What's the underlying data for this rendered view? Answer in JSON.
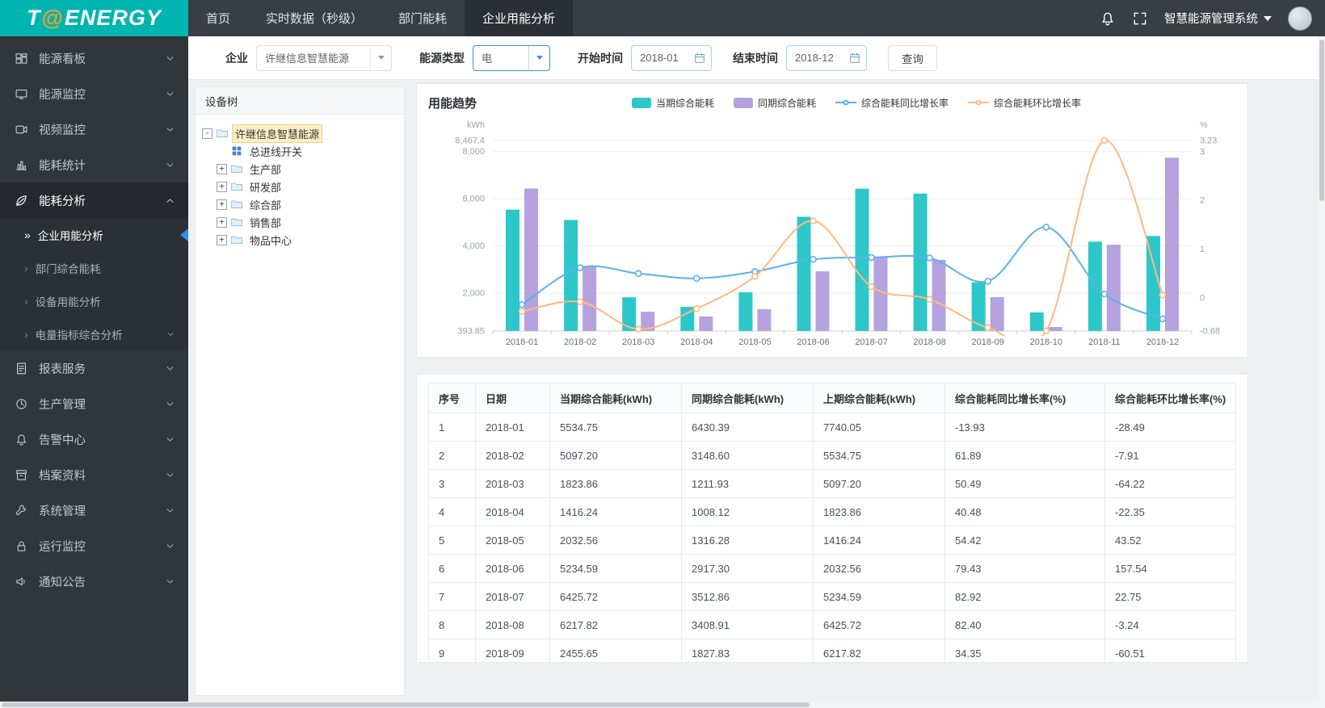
{
  "app": {
    "logo": {
      "part1": "T",
      "at": "@",
      "part2": "ENERGY"
    },
    "system_title": "智慧能源管理系统"
  },
  "colors": {
    "brand_teal": "#00b5b0",
    "bar_current": "#2ec7c9",
    "bar_same_period": "#b6a2de",
    "line_yoy": "#5ab1ef",
    "line_mom": "#ffb980",
    "active_arrow_blue": "#2d8cf0"
  },
  "topnav": {
    "tabs": [
      {
        "key": "home",
        "label": "首页",
        "active": false
      },
      {
        "key": "realtime-data",
        "label": "实时数据（秒级）",
        "active": false
      },
      {
        "key": "department-energy",
        "label": "部门能耗",
        "active": false
      },
      {
        "key": "enterprise-energy-analysis",
        "label": "企业用能分析",
        "active": true
      }
    ]
  },
  "sidebar": {
    "items": [
      {
        "key": "energy-board",
        "icon": "dashboard",
        "label": "能源看板",
        "chevron": true
      },
      {
        "key": "energy-monitor",
        "icon": "monitor",
        "label": "能源监控",
        "chevron": true
      },
      {
        "key": "video-monitor",
        "icon": "video",
        "label": "视频监控",
        "chevron": true
      },
      {
        "key": "energy-stats",
        "icon": "stats",
        "label": "能耗统计",
        "chevron": true
      },
      {
        "key": "energy-analysis",
        "icon": "leaf",
        "label": "能耗分析",
        "chevron": true,
        "active": true,
        "expanded": true,
        "children": [
          {
            "key": "enterprise-energy-analysis",
            "label": "企业用能分析",
            "active": true
          },
          {
            "key": "dept-comprehensive-energy",
            "label": "部门综合能耗"
          },
          {
            "key": "device-energy-analysis",
            "label": "设备用能分析"
          },
          {
            "key": "power-indicator-analysis",
            "label": "电量指标综合分析",
            "chevron": true
          }
        ]
      },
      {
        "key": "report-service",
        "icon": "report",
        "label": "报表服务",
        "chevron": true
      },
      {
        "key": "production-mgmt",
        "icon": "clock",
        "label": "生产管理",
        "chevron": true
      },
      {
        "key": "alarm-center",
        "icon": "bell",
        "label": "告警中心",
        "chevron": true
      },
      {
        "key": "archives",
        "icon": "archive",
        "label": "档案资料",
        "chevron": true
      },
      {
        "key": "system-mgmt",
        "icon": "wrench",
        "label": "系统管理",
        "chevron": true
      },
      {
        "key": "operation-monitor",
        "icon": "lock",
        "label": "运行监控",
        "chevron": true
      },
      {
        "key": "notice",
        "icon": "speaker",
        "label": "通知公告",
        "chevron": true
      }
    ]
  },
  "filters": {
    "enterprise_label": "企业",
    "enterprise_value": "许继信息智慧能源",
    "energy_type_label": "能源类型",
    "energy_type_value": "电",
    "start_label": "开始时间",
    "start_value": "2018-01",
    "end_label": "结束时间",
    "end_value": "2018-12",
    "query_button": "查询"
  },
  "device_tree": {
    "header": "设备树",
    "root": {
      "label": "许继信息智慧能源",
      "toggle": "-",
      "selected": true
    },
    "children": [
      {
        "label": "总进线开关",
        "type": "device"
      },
      {
        "label": "生产部",
        "type": "folder",
        "toggle": "+"
      },
      {
        "label": "研发部",
        "type": "folder",
        "toggle": "+"
      },
      {
        "label": "综合部",
        "type": "folder",
        "toggle": "+"
      },
      {
        "label": "销售部",
        "type": "folder",
        "toggle": "+"
      },
      {
        "label": "物品中心",
        "type": "folder",
        "toggle": "+"
      }
    ]
  },
  "chart_data": {
    "type": "bar+line",
    "title": "用能趋势",
    "unit_left": "kWh",
    "unit_right": "%",
    "grid": true,
    "legend_position": "top-center",
    "categories": [
      "2018-01",
      "2018-02",
      "2018-03",
      "2018-04",
      "2018-05",
      "2018-06",
      "2018-07",
      "2018-08",
      "2018-09",
      "2018-10",
      "2018-11",
      "2018-12"
    ],
    "series": [
      {
        "name": "当期综合能耗",
        "type": "bar",
        "axis": "left",
        "color": "#2ec7c9",
        "values": [
          5534.75,
          5097.2,
          1823.86,
          1416.24,
          2032.56,
          5234.59,
          6425.72,
          6217.82,
          2455.65,
          1180,
          4180,
          4420
        ]
      },
      {
        "name": "同期综合能耗",
        "type": "bar",
        "axis": "left",
        "color": "#b6a2de",
        "values": [
          6430.39,
          3148.6,
          1211.93,
          1008.12,
          1316.28,
          2917.3,
          3512.86,
          3408.91,
          1827.83,
          560,
          4050,
          7740.05
        ]
      },
      {
        "name": "综合能耗同比增长率",
        "type": "line",
        "axis": "right",
        "color": "#5ab1ef",
        "values": [
          -0.14,
          0.62,
          0.5,
          0.4,
          0.54,
          0.79,
          0.83,
          0.82,
          0.34,
          1.45,
          0.08,
          -0.43
        ]
      },
      {
        "name": "综合能耗环比增长率",
        "type": "line",
        "axis": "right",
        "color": "#ffb980",
        "values": [
          -0.28,
          -0.08,
          -0.64,
          -0.22,
          0.44,
          1.58,
          0.23,
          -0.03,
          -0.61,
          -0.68,
          3.23,
          0.06
        ]
      }
    ],
    "left_axis": {
      "min": 393.85,
      "max": 8467.4,
      "ticks": [
        393.85,
        2000,
        4000,
        6000,
        8000,
        8467.4
      ],
      "tick_labels": [
        "393.85",
        "2,000",
        "4,000",
        "6,000",
        "8,000",
        "8,467.4"
      ]
    },
    "right_axis": {
      "min": -0.68,
      "max": 3.23,
      "ticks": [
        -0.68,
        0,
        1,
        2,
        3,
        3.23
      ],
      "tick_labels": [
        "-0.68",
        "0",
        "1",
        "2",
        "3",
        "3.23"
      ]
    }
  },
  "table": {
    "headers": [
      "序号",
      "日期",
      "当期综合能耗(kWh)",
      "同期综合能耗(kWh)",
      "上期综合能耗(kWh)",
      "综合能耗同比增长率(%)",
      "综合能耗环比增长率(%)"
    ],
    "rows": [
      [
        "1",
        "2018-01",
        "5534.75",
        "6430.39",
        "7740.05",
        "-13.93",
        "-28.49"
      ],
      [
        "2",
        "2018-02",
        "5097.20",
        "3148.60",
        "5534.75",
        "61.89",
        "-7.91"
      ],
      [
        "3",
        "2018-03",
        "1823.86",
        "1211.93",
        "5097.20",
        "50.49",
        "-64.22"
      ],
      [
        "4",
        "2018-04",
        "1416.24",
        "1008.12",
        "1823.86",
        "40.48",
        "-22.35"
      ],
      [
        "5",
        "2018-05",
        "2032.56",
        "1316.28",
        "1416.24",
        "54.42",
        "43.52"
      ],
      [
        "6",
        "2018-06",
        "5234.59",
        "2917.30",
        "2032.56",
        "79.43",
        "157.54"
      ],
      [
        "7",
        "2018-07",
        "6425.72",
        "3512.86",
        "5234.59",
        "82.92",
        "22.75"
      ],
      [
        "8",
        "2018-08",
        "6217.82",
        "3408.91",
        "6425.72",
        "82.40",
        "-3.24"
      ],
      [
        "9",
        "2018-09",
        "2455.65",
        "1827.83",
        "6217.82",
        "34.35",
        "-60.51"
      ]
    ]
  }
}
